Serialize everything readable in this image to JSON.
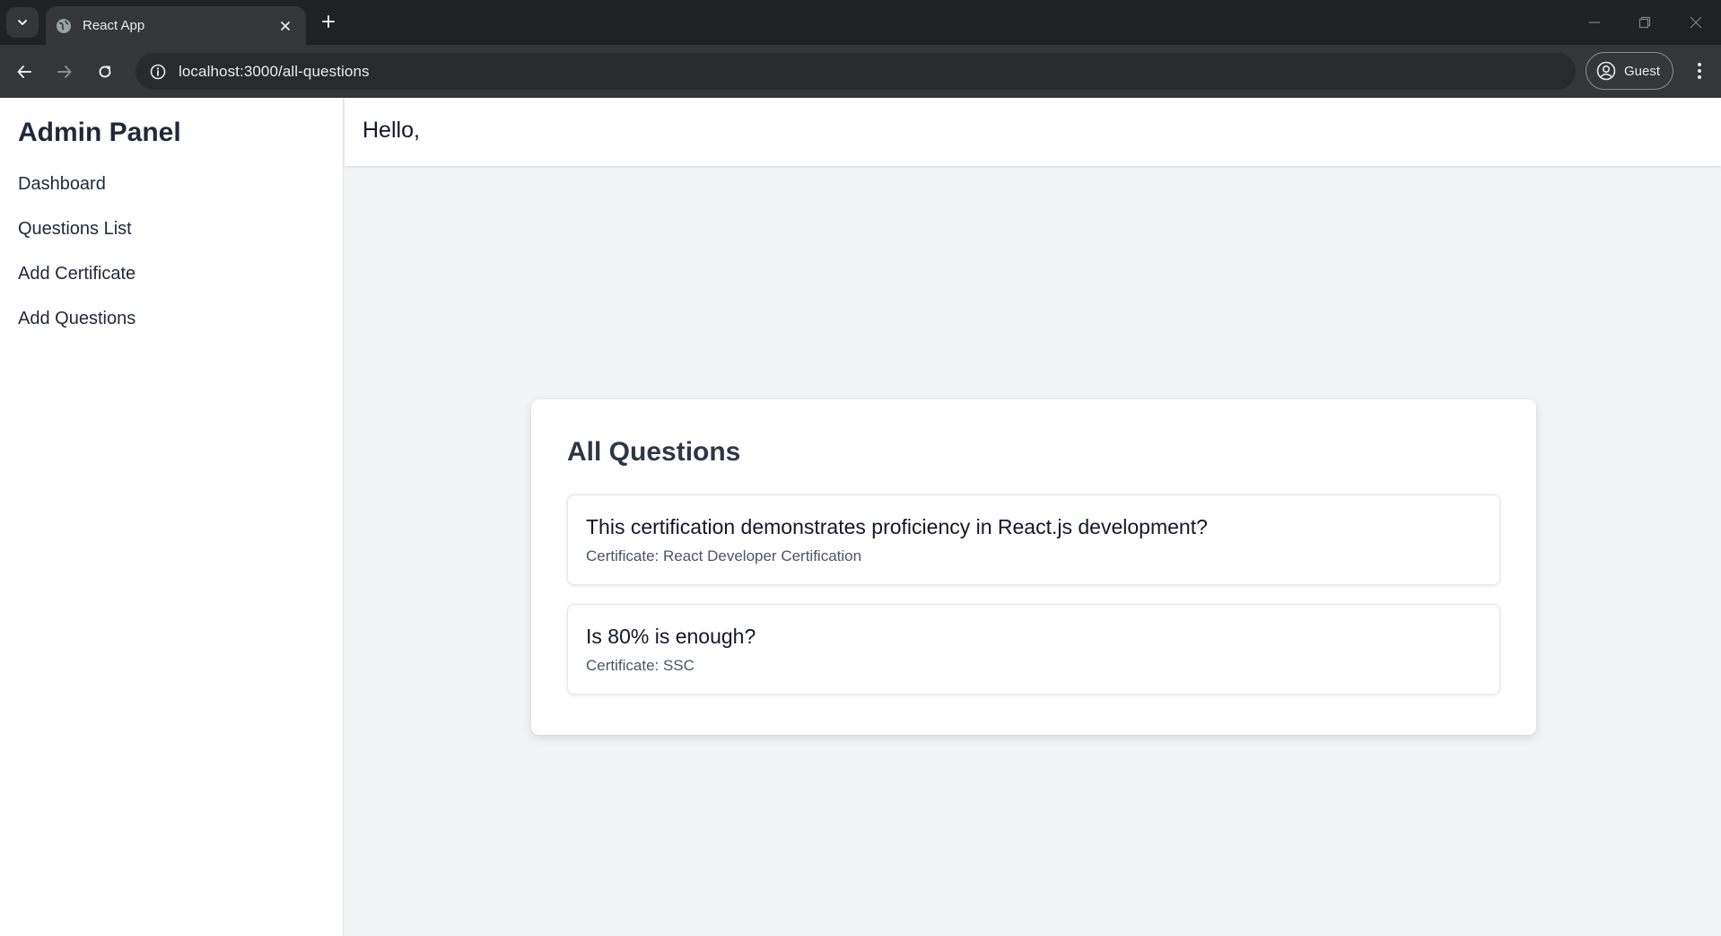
{
  "browser": {
    "tab_title": "React App",
    "url": "localhost:3000/all-questions",
    "profile_label": "Guest",
    "icons": [
      "tab-search-icon",
      "globe-icon",
      "close-icon",
      "plus-icon",
      "minimize-icon",
      "restore-icon",
      "window-close-icon",
      "back-arrow-icon",
      "forward-arrow-icon",
      "reload-icon",
      "info-icon",
      "profile-icon",
      "kebab-menu-icon"
    ]
  },
  "sidebar": {
    "title": "Admin Panel",
    "items": [
      {
        "label": "Dashboard"
      },
      {
        "label": "Questions List"
      },
      {
        "label": "Add Certificate"
      },
      {
        "label": "Add Questions"
      }
    ]
  },
  "header": {
    "greeting": "Hello,"
  },
  "main": {
    "title": "All Questions",
    "questions": [
      {
        "text": "This certification demonstrates proficiency in React.js development?",
        "certificate": "Certificate: React Developer Certification"
      },
      {
        "text": "Is 80% is enough?",
        "certificate": "Certificate: SSC"
      }
    ]
  },
  "colors": {
    "chrome_dark": "#202124",
    "chrome_toolbar": "#35363a",
    "page_bg": "#f3f4f6",
    "text_dark": "#1f2937"
  }
}
